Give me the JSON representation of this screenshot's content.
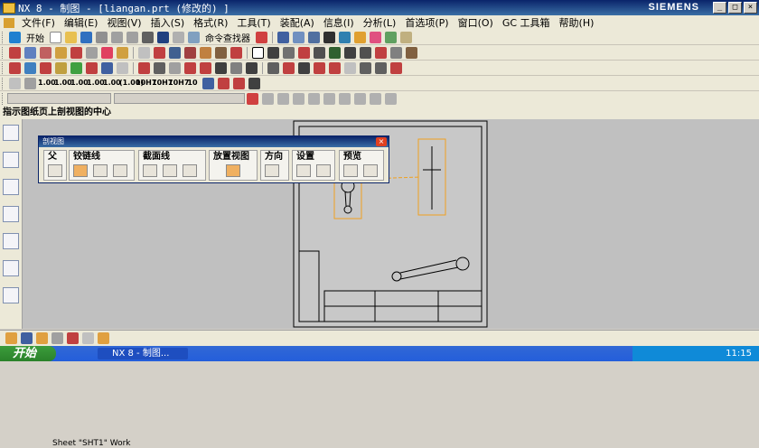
{
  "title": {
    "text": "NX 8 - 制图 - [liangan.prt  (修改的) ]",
    "brand": "SIEMENS"
  },
  "menu": {
    "items": [
      "文件(F)",
      "编辑(E)",
      "视图(V)",
      "插入(S)",
      "格式(R)",
      "工具(T)",
      "装配(A)",
      "信息(I)",
      "分析(L)",
      "首选项(P)",
      "窗口(O)",
      "GC 工具箱",
      "帮助(H)"
    ]
  },
  "toolbar1": {
    "start_label": "开始",
    "finder_label": "命令查找器"
  },
  "toolbar4": {
    "num1": "1.00",
    "num2": "1.00",
    "num3": "1.00",
    "num4": "1.00",
    "num5": "1.00",
    "num6": "(1.00)",
    "num7": "10H7",
    "num8": "10H7",
    "num9": "10H7",
    "num10": "10"
  },
  "cue": {
    "text": "指示图纸页上剖视图的中心"
  },
  "dialog": {
    "title": "剖视图",
    "groups": [
      "父",
      "铰链线",
      "截面线",
      "放置视图",
      "方向",
      "设置",
      "预览"
    ]
  },
  "status": {
    "sheet": "Sheet \"SHT1\" Work"
  },
  "taskbar": {
    "start": "开始",
    "task": "NX 8 - 制图...",
    "time": "11:15"
  },
  "colors": {
    "accent": "#0a246a",
    "canvas": "#c0c0c0",
    "highlight": "#f0a020"
  }
}
